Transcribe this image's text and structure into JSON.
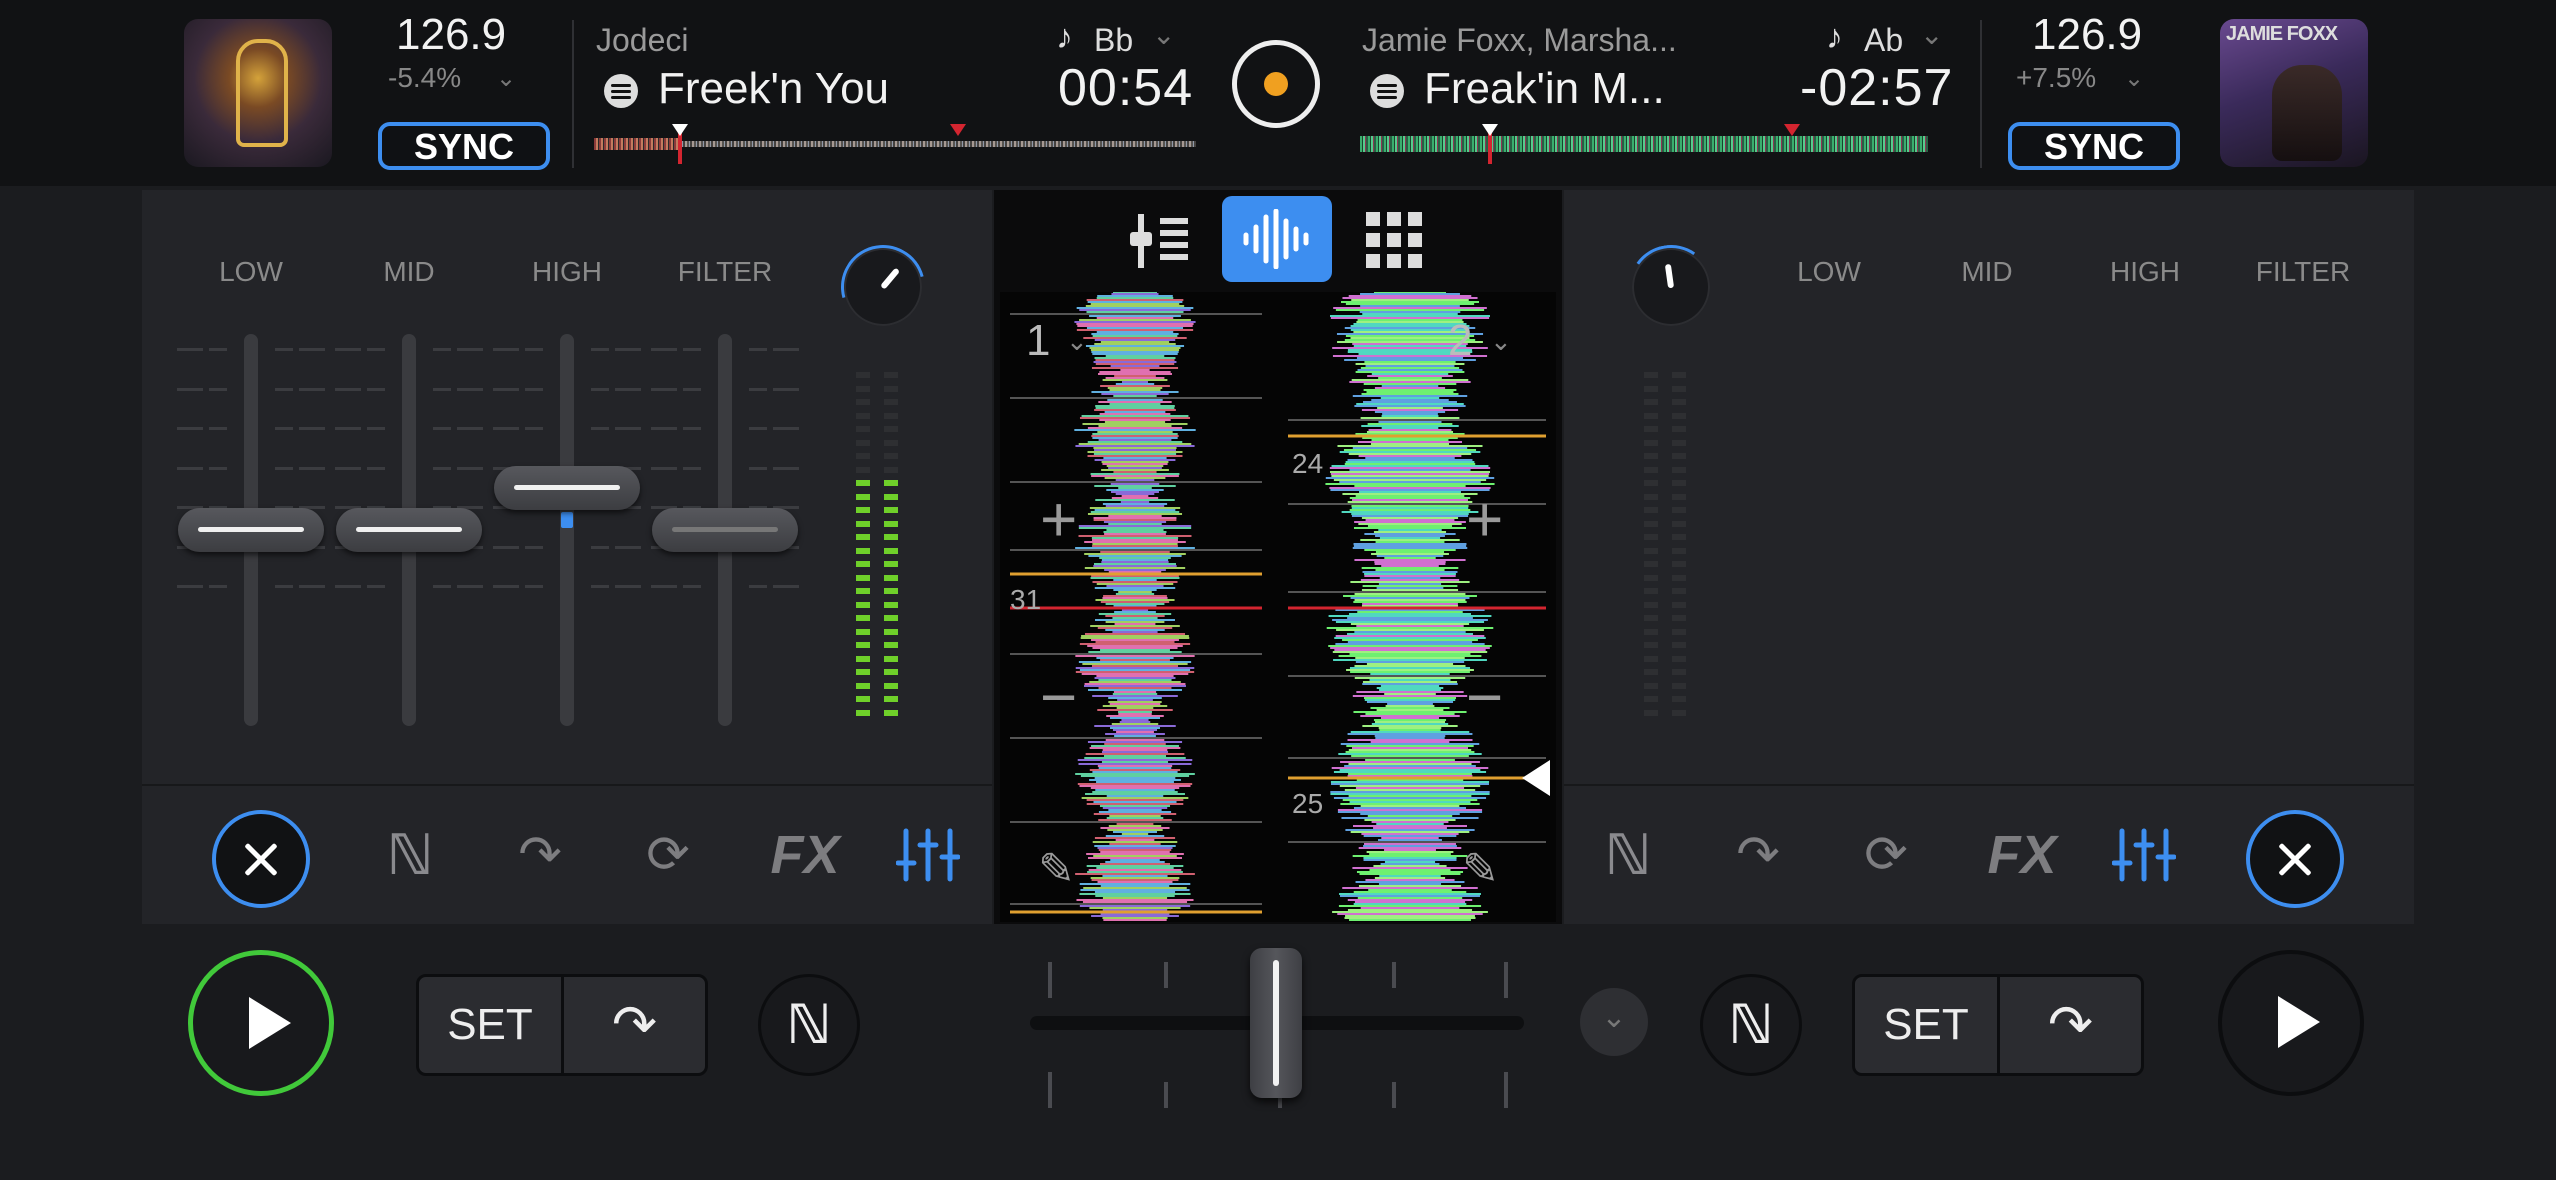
{
  "deck1": {
    "bpm": "126.9",
    "pitch": "-5.4%",
    "sync_label": "SYNC",
    "artist": "Jodeci",
    "title": "Freek'n You",
    "key": "Bb",
    "time": "00:54",
    "deck_number": "1",
    "eq_labels": [
      "LOW",
      "MID",
      "HIGH",
      "FILTER"
    ],
    "beat_marker_label": "31",
    "set_label": "SET",
    "play_active": true,
    "accent": "#41c93a"
  },
  "deck2": {
    "bpm": "126.9",
    "pitch": "+7.5%",
    "sync_label": "SYNC",
    "artist": "Jamie Foxx, Marsha...",
    "title": "Freak'in M...",
    "key": "Ab",
    "time": "-02:57",
    "deck_number": "2",
    "eq_labels": [
      "LOW",
      "MID",
      "HIGH",
      "FILTER"
    ],
    "beat_marker_labels": [
      "24",
      "25"
    ],
    "cover_text": "JAMIE FOXX",
    "set_label": "SET",
    "play_active": false
  },
  "center": {
    "view_tabs": [
      "mixer-view-icon",
      "waveform-view-icon",
      "pads-view-icon"
    ],
    "active_tab": "waveform-view-icon",
    "zoom_in": "+",
    "zoom_out": "−"
  },
  "colors": {
    "accent_blue": "#3d8ef0",
    "play_green": "#41c93a",
    "meter_green": "#6fd02a",
    "cue_red": "#d42530"
  }
}
